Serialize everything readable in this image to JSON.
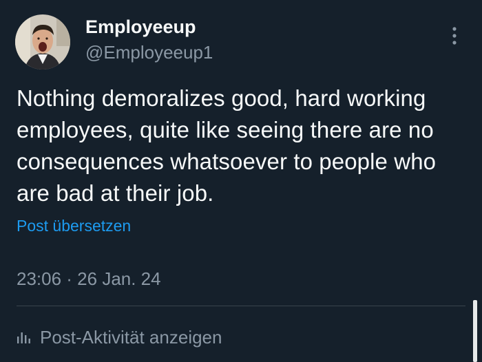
{
  "author": {
    "display_name": "Employeeup",
    "handle": "@Employeeup1"
  },
  "post": {
    "text": "Nothing demoralizes good, hard working employees, quite like seeing there are no consequences whatsoever to people who are bad at their job.",
    "translate_label": "Post übersetzen",
    "timestamp": "23:06 · 26 Jan. 24"
  },
  "footer": {
    "activity_label": "Post-Aktivität anzeigen"
  },
  "icons": {
    "more": "more-vertical-icon",
    "analytics": "analytics-bars-icon"
  },
  "colors": {
    "background": "#15202b",
    "primary_text": "#f7f9f9",
    "secondary_text": "#8b98a5",
    "link": "#1d9bf0",
    "divider": "#38444d"
  }
}
